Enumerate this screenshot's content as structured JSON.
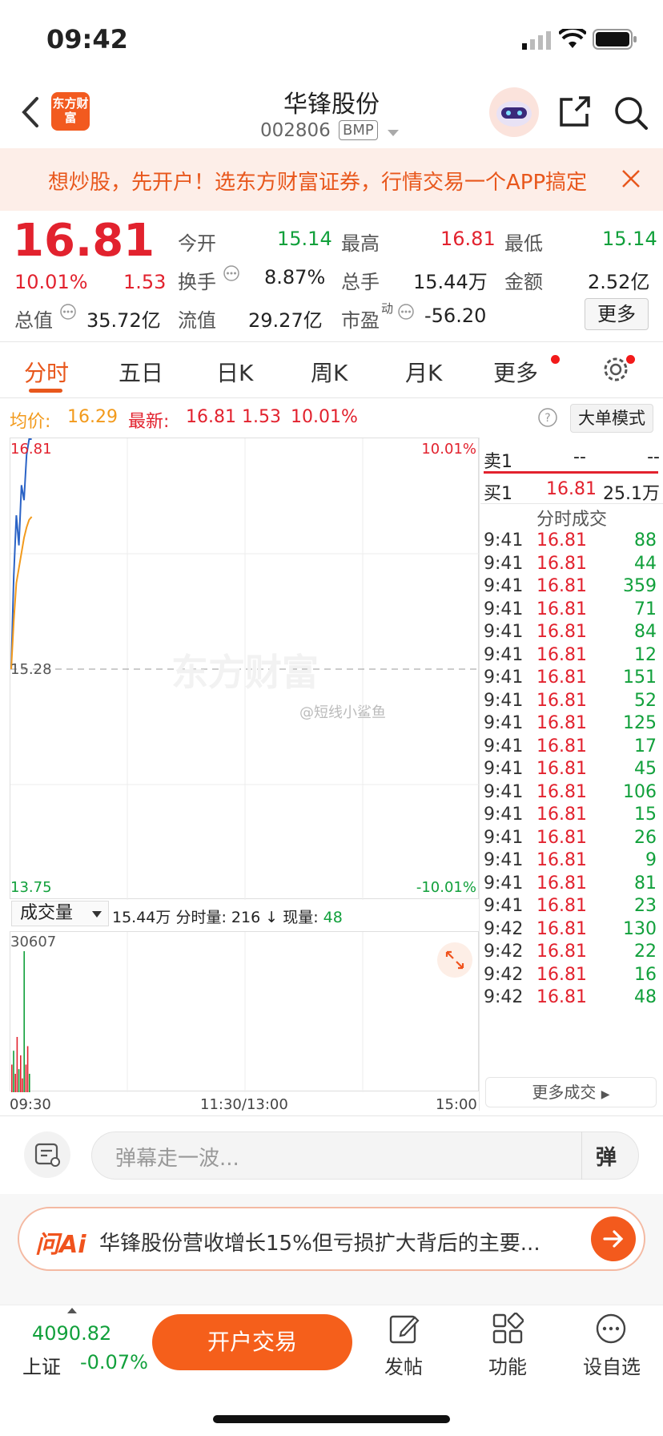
{
  "status": {
    "time": "09:42"
  },
  "header": {
    "name": "华锋股份",
    "code": "002806",
    "badge": "BMP",
    "logo": "东方财富"
  },
  "banner": {
    "text": "想炒股，先开户！选东方财富证券，行情交易一个APP搞定"
  },
  "quote": {
    "price": "16.81",
    "change_pct": "10.01%",
    "change": "1.53",
    "open_label": "今开",
    "open": "15.14",
    "high_label": "最高",
    "high": "16.81",
    "low_label": "最低",
    "low": "15.14",
    "turnover_label": "换手",
    "turnover": "8.87%",
    "volume_label": "总手",
    "volume": "15.44万",
    "amount_label": "金额",
    "amount": "2.52亿",
    "mktcap_label": "总值",
    "mktcap": "35.72亿",
    "float_label": "流值",
    "float": "29.27亿",
    "pe_label": "市盈",
    "pe_sup": "动",
    "pe": "-56.20",
    "more": "更多"
  },
  "tabs": [
    "分时",
    "五日",
    "日K",
    "周K",
    "月K",
    "更多"
  ],
  "info": {
    "avg_label": "均价:",
    "avg": "16.29",
    "latest_label": "最新:",
    "latest": "16.81",
    "chg": "1.53",
    "pct": "10.01%",
    "mode": "大单模式"
  },
  "chart": {
    "top": "16.81",
    "mid": "15.28",
    "bottom": "13.75",
    "top_pct": "10.01%",
    "bottom_pct": "-10.01%",
    "watermark": "东方财富",
    "weibo": "@短线小鲨鱼",
    "vol_select": "成交量",
    "vol_total": "15.44万",
    "min_vol_label": "分时量:",
    "min_vol": "216",
    "arrow": "↓",
    "now_vol_label": "现量:",
    "now_vol": "48",
    "vol_max": "30607",
    "x_start": "09:30",
    "x_mid": "11:30/13:00",
    "x_end": "15:00"
  },
  "chart_data": {
    "type": "line",
    "series": [
      {
        "name": "最新",
        "values": [
          15.28,
          15.9,
          16.3,
          16.1,
          16.5,
          16.4,
          16.7,
          16.81,
          16.81
        ]
      },
      {
        "name": "均价",
        "values": [
          15.28,
          15.6,
          15.85,
          15.95,
          16.05,
          16.15,
          16.22,
          16.27,
          16.29
        ]
      }
    ],
    "ylim": [
      13.75,
      16.81
    ],
    "volume": [
      6000,
      9000,
      4000,
      12000,
      5000,
      8000,
      3000,
      30607,
      6000,
      10000,
      4000
    ],
    "vol_ylim": [
      0,
      30607
    ]
  },
  "orderbook": {
    "sell_label": "卖1",
    "sell_price": "--",
    "sell_vol": "--",
    "buy_label": "买1",
    "buy_price": "16.81",
    "buy_vol": "25.1万",
    "ticks_title": "分时成交"
  },
  "ticks": [
    {
      "t": "9:41",
      "p": "16.81",
      "v": "88"
    },
    {
      "t": "9:41",
      "p": "16.81",
      "v": "44"
    },
    {
      "t": "9:41",
      "p": "16.81",
      "v": "359"
    },
    {
      "t": "9:41",
      "p": "16.81",
      "v": "71"
    },
    {
      "t": "9:41",
      "p": "16.81",
      "v": "84"
    },
    {
      "t": "9:41",
      "p": "16.81",
      "v": "12"
    },
    {
      "t": "9:41",
      "p": "16.81",
      "v": "151"
    },
    {
      "t": "9:41",
      "p": "16.81",
      "v": "52"
    },
    {
      "t": "9:41",
      "p": "16.81",
      "v": "125"
    },
    {
      "t": "9:41",
      "p": "16.81",
      "v": "17"
    },
    {
      "t": "9:41",
      "p": "16.81",
      "v": "45"
    },
    {
      "t": "9:41",
      "p": "16.81",
      "v": "106"
    },
    {
      "t": "9:41",
      "p": "16.81",
      "v": "15"
    },
    {
      "t": "9:41",
      "p": "16.81",
      "v": "26"
    },
    {
      "t": "9:41",
      "p": "16.81",
      "v": "9"
    },
    {
      "t": "9:41",
      "p": "16.81",
      "v": "81"
    },
    {
      "t": "9:41",
      "p": "16.81",
      "v": "23"
    },
    {
      "t": "9:42",
      "p": "16.81",
      "v": "130"
    },
    {
      "t": "9:42",
      "p": "16.81",
      "v": "22"
    },
    {
      "t": "9:42",
      "p": "16.81",
      "v": "16"
    },
    {
      "t": "9:42",
      "p": "16.81",
      "v": "48"
    }
  ],
  "more_trades": "更多成交",
  "comment": {
    "placeholder": "弹幕走一波...",
    "dan": "弹"
  },
  "ai": {
    "logo": "问Ai",
    "text": "华锋股份营收增长15%但亏损扩大背后的主要..."
  },
  "bottom": {
    "index_value": "4090.82",
    "index_name": "上证",
    "index_pct": "-0.07%",
    "open_trade": "开户交易",
    "post": "发帖",
    "func": "功能",
    "watch": "设自选"
  },
  "colors": {
    "up": "#e2222e",
    "down": "#11a03b",
    "accent": "#f55f1b",
    "price_line": "#2b63c6",
    "avg_line": "#f29a1c"
  }
}
